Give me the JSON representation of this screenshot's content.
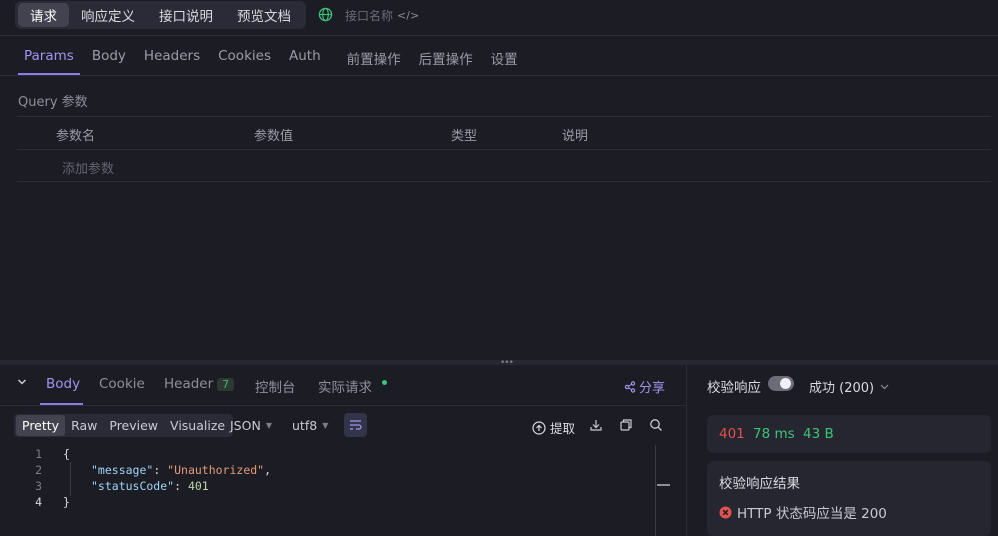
{
  "top_tabs": [
    "请求",
    "响应定义",
    "接口说明",
    "预览文档"
  ],
  "api_name": {
    "placeholder": "接口名称",
    "code_glyph": "</>"
  },
  "request_tabs": [
    "Params",
    "Body",
    "Headers",
    "Cookies",
    "Auth",
    "前置操作",
    "后置操作",
    "设置"
  ],
  "query": {
    "label": "Query 参数",
    "columns": [
      "参数名",
      "参数值",
      "类型",
      "说明"
    ],
    "add_placeholder": "添加参数"
  },
  "response": {
    "tabs": {
      "body": "Body",
      "cookie": "Cookie",
      "header": "Header",
      "header_count": "7",
      "console": "控制台",
      "actual": "实际请求"
    },
    "share": "分享",
    "view_modes": [
      "Pretty",
      "Raw",
      "Preview",
      "Visualize"
    ],
    "format": "JSON",
    "encoding": "utf8",
    "extract": "提取",
    "code": {
      "line_numbers": [
        "1",
        "2",
        "3",
        "4"
      ],
      "open": "{",
      "message_key": "\"message\"",
      "message_value": "\"Unauthorized\"",
      "status_key": "\"statusCode\"",
      "status_value": "401",
      "close": "}"
    }
  },
  "validation": {
    "label": "校验响应",
    "toggle_on": true,
    "success": "成功 (200)",
    "status_code": "401",
    "time": "78 ms",
    "size": "43 B",
    "result_title": "校验响应结果",
    "error_text": "HTTP 状态码应当是 200"
  },
  "colors": {
    "accent": "#8c7ae6",
    "status_error": "#e0524f",
    "status_ok": "#3ec37a"
  }
}
